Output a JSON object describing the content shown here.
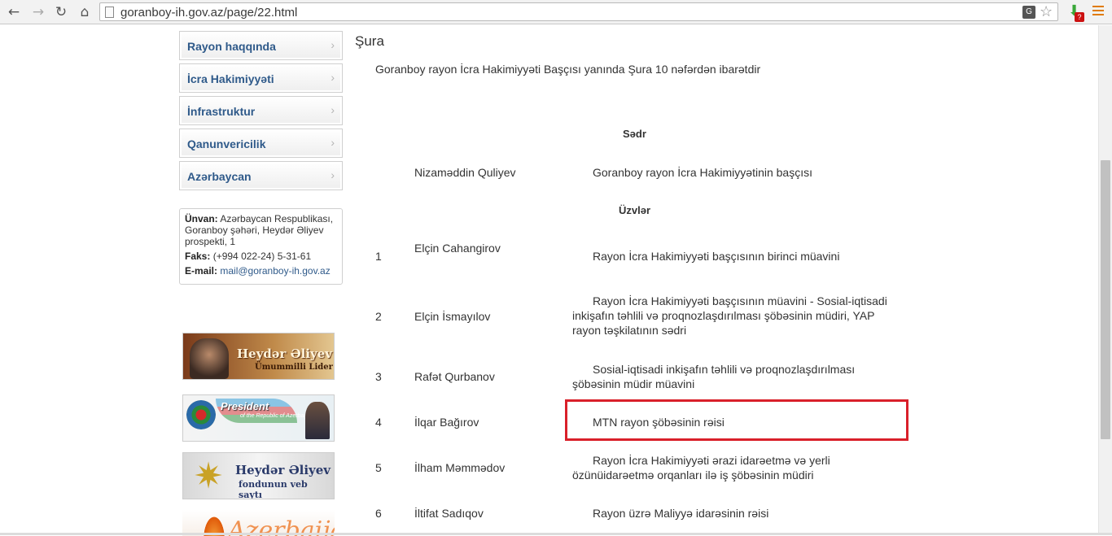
{
  "browser": {
    "url": "goranboy-ih.gov.az/page/22.html",
    "nav": {
      "back": "←",
      "forward": "→",
      "reload": "↻",
      "home": "⌂"
    },
    "icons": [
      "page-icon",
      "translate-icon",
      "star-icon",
      "download-extension-icon",
      "menu-icon"
    ],
    "ext_badge": "?",
    "translate_glyph": "G"
  },
  "sidebar": {
    "menu": [
      {
        "label": "Rayon haqqında"
      },
      {
        "label": "İcra Hakimiyyəti"
      },
      {
        "label": "İnfrastruktur"
      },
      {
        "label": "Qanunvericilik"
      },
      {
        "label": "Azərbaycan"
      }
    ],
    "chevron": "›",
    "contact": {
      "address_label": "Ünvan:",
      "address": "Azərbaycan Respublikası, Goranboy şəhəri, Heydər Əliyev prospekti, 1",
      "fax_label": "Faks:",
      "fax": "(+994 022-24) 5-31-61",
      "email_label": "E-mail:",
      "email": "mail@goranboy-ih.gov.az"
    },
    "banners": {
      "heydar": {
        "title": "Heydər Əliyev",
        "subtitle": "Ümummilli Lider"
      },
      "president": {
        "title": "President",
        "subtitle": "of the Republic of Azerbaijan"
      },
      "fund": {
        "title": "Heydər Əliyev",
        "subtitle": "fondunun veb saytı"
      },
      "azerbaijan": {
        "title": "Azerbaijan"
      }
    }
  },
  "main": {
    "title": "Şura",
    "intro": "Goranboy rayon İcra Hakimiyyəti Başçısı yanında Şura 10 nəfərdən ibarətdir",
    "chair_heading": "Sədr",
    "chair": {
      "name": "Nizaməddin Quliyev",
      "role": "Goranboy rayon İcra Hakimiyyətinin başçısı"
    },
    "members_heading": "Üzvlər",
    "members": [
      {
        "num": "1",
        "name": "Elçin Cahangirov",
        "role": "Rayon İcra Hakimiyyəti başçısının birinci müavini"
      },
      {
        "num": "2",
        "name": "Elçin  İsmayılov",
        "role": "Rayon İcra Hakimiyyəti başçısının müavini - Sosial-iqtisadi inkişafın   təhlili və proqnozlaşdırılması şöbəsinin müdiri, YAP rayon təşkilatının sədri"
      },
      {
        "num": "3",
        "name": "Rafət Qurbanov",
        "role": "Sosial-iqtisadi inkişafın   təhlili və proqnozlaşdırılması şöbəsinin müdir müavini"
      },
      {
        "num": "4",
        "name": "İlqar Bağırov",
        "role": "MTN rayon şöbəsinin rəisi"
      },
      {
        "num": "5",
        "name": "İlham Məmmədov",
        "role": "Rayon İcra Hakimiyyəti ərazi idarəetmə və yerli özünüidarəetmə orqanları ilə iş şöbəsinin müdiri"
      },
      {
        "num": "6",
        "name": "İltifat Sadıqov",
        "role": "Rayon üzrə Maliyyə idarəsinin rəisi"
      }
    ],
    "highlight_color": "#d9202a"
  }
}
